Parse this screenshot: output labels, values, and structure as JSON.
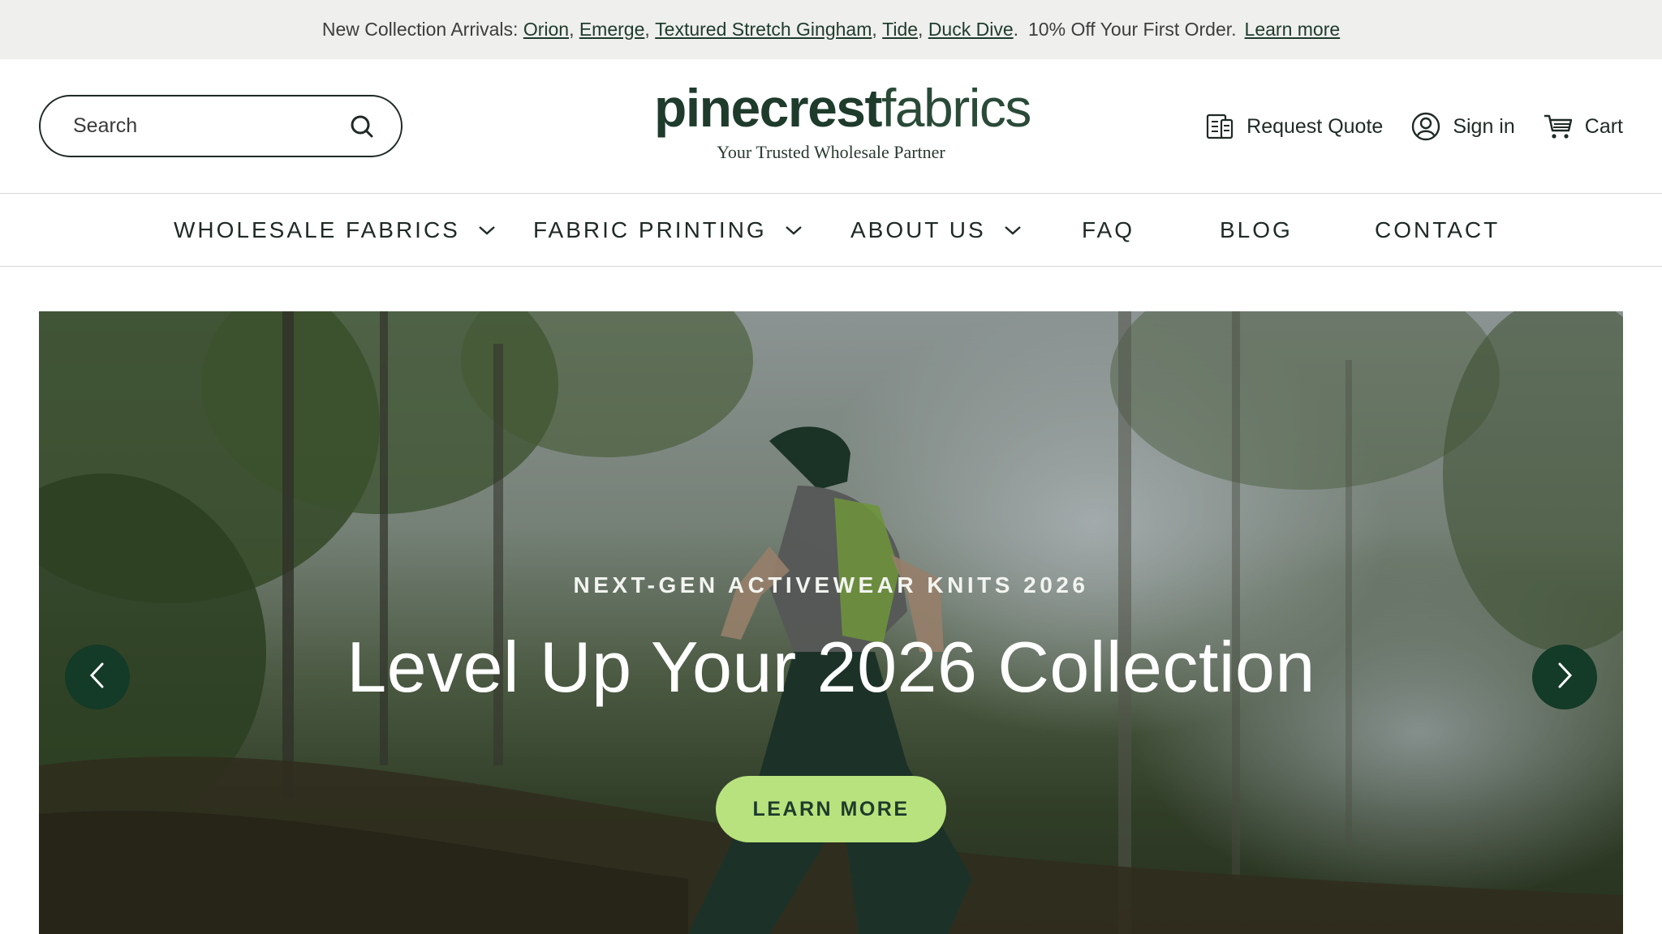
{
  "announcement": {
    "prefix": "New Collection Arrivals:",
    "links": [
      "Orion",
      "Emerge",
      "Textured Stretch Gingham",
      "Tide",
      "Duck Dive"
    ],
    "offer": "10% Off Your First Order.",
    "learn_more": "Learn more"
  },
  "header": {
    "search_placeholder": "Search",
    "logo_bold": "pinecrest",
    "logo_light": "fabrics",
    "tagline": "Your Trusted Wholesale Partner",
    "request_quote": "Request Quote",
    "sign_in": "Sign in",
    "cart": "Cart"
  },
  "nav": {
    "items": [
      {
        "label": "WHOLESALE FABRICS",
        "has_dropdown": true
      },
      {
        "label": "FABRIC PRINTING",
        "has_dropdown": true
      },
      {
        "label": "ABOUT US",
        "has_dropdown": true
      },
      {
        "label": "FAQ",
        "has_dropdown": false
      },
      {
        "label": "BLOG",
        "has_dropdown": false
      },
      {
        "label": "CONTACT",
        "has_dropdown": false
      }
    ]
  },
  "hero": {
    "eyebrow": "NEXT-GEN ACTIVEWEAR KNITS 2026",
    "headline": "Level Up Your 2026 Collection",
    "cta": "LEARN MORE",
    "prev_icon": "chevron-left-icon",
    "next_icon": "chevron-right-icon"
  },
  "colors": {
    "brand_green": "#1e3b2c",
    "cta_green": "#b7e27d",
    "arrow_bg": "#143a28",
    "announce_bg": "#efefed"
  }
}
